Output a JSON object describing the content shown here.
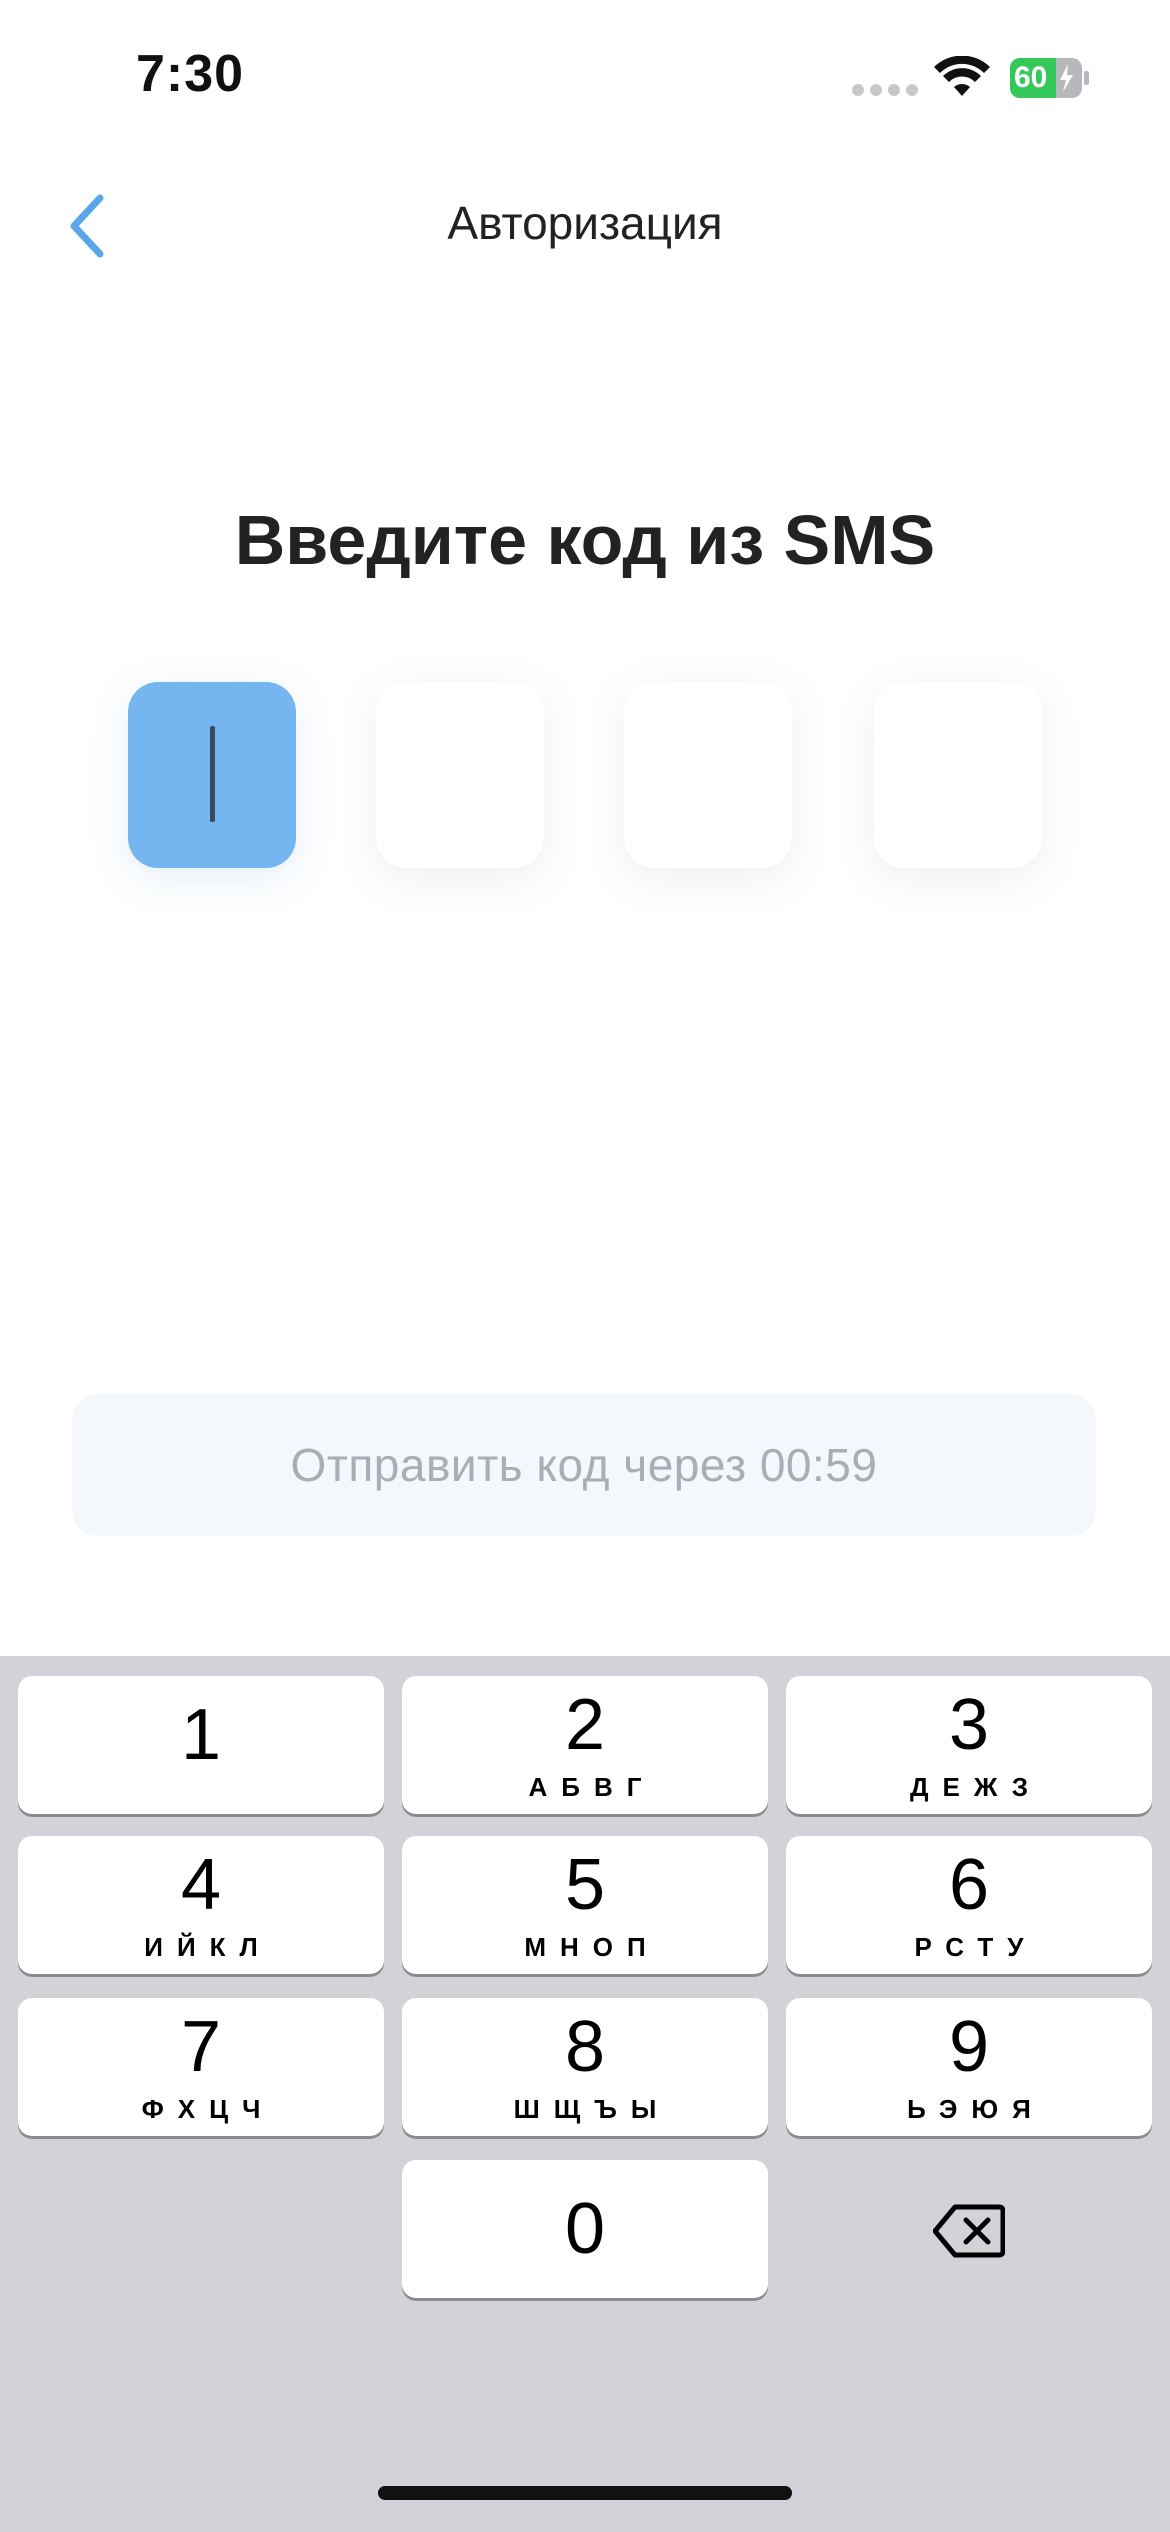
{
  "status_bar": {
    "time": "7:30",
    "battery_level": "60",
    "icons": [
      "signal-dots-icon",
      "wifi-icon",
      "battery-charging-icon"
    ]
  },
  "nav": {
    "back_icon": "chevron-left-icon",
    "title": "Авторизация"
  },
  "heading": "Введите код из SMS",
  "code": {
    "length": 4,
    "active_index": 0,
    "values": [
      "",
      "",
      "",
      ""
    ]
  },
  "resend": {
    "label": "Отправить код через 00:59"
  },
  "keyboard": {
    "keys": [
      {
        "digit": "1",
        "letters": ""
      },
      {
        "digit": "2",
        "letters": "АБВГ"
      },
      {
        "digit": "3",
        "letters": "ДЕЖЗ"
      },
      {
        "digit": "4",
        "letters": "ИЙКЛ"
      },
      {
        "digit": "5",
        "letters": "МНОП"
      },
      {
        "digit": "6",
        "letters": "РСТУ"
      },
      {
        "digit": "7",
        "letters": "ФХЦЧ"
      },
      {
        "digit": "8",
        "letters": "ШЩЪЫ"
      },
      {
        "digit": "9",
        "letters": "ЬЭЮЯ"
      },
      {
        "digit": "0",
        "letters": ""
      }
    ],
    "backspace_icon": "backspace-icon"
  },
  "colors": {
    "accent": "#75b5f0",
    "back_icon": "#5aa6ea",
    "battery": "#34c759",
    "keyboard_bg": "#d1d3d9"
  }
}
